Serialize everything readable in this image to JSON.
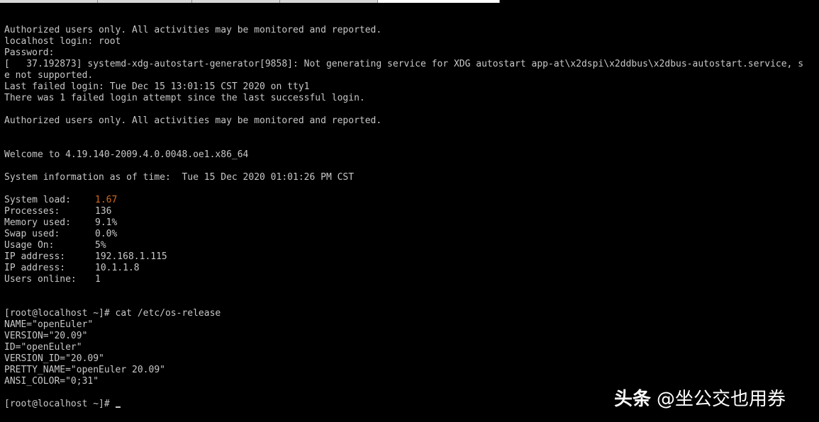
{
  "colors": {
    "background": "#000000",
    "text": "#c8c8c8",
    "highlight": "#d2691e",
    "watermark": "#ffffff"
  },
  "output_top": [
    "Authorized users only. All activities may be monitored and reported.",
    "localhost login: root",
    "Password:",
    "[   37.192873] systemd-xdg-autostart-generator[9858]: Not generating service for XDG autostart app-at\\x2dspi\\x2ddbus\\x2dbus-autostart.service, s",
    "e not supported.",
    "Last failed login: Tue Dec 15 13:01:15 CST 2020 on tty1",
    "There was 1 failed login attempt since the last successful login.",
    "",
    "Authorized users only. All activities may be monitored and reported.",
    "",
    "",
    "Welcome to 4.19.140-2009.4.0.0048.oe1.x86_64",
    "",
    "System information as of time:  Tue 15 Dec 2020 01:01:26 PM CST",
    ""
  ],
  "sysinfo": [
    {
      "label": "System load:",
      "value": "1.67"
    },
    {
      "label": "Processes:",
      "value": "136"
    },
    {
      "label": "Memory used:",
      "value": "9.1%"
    },
    {
      "label": "Swap used:",
      "value": "0.0%"
    },
    {
      "label": "Usage On:",
      "value": "5%"
    },
    {
      "label": "IP address:",
      "value": "192.168.1.115"
    },
    {
      "label": "IP address:",
      "value": "10.1.1.8"
    },
    {
      "label": "Users online:",
      "value": "1"
    }
  ],
  "output_bottom": [
    "",
    "",
    "[root@localhost ~]# cat /etc/os-release",
    "NAME=\"openEuler\"",
    "VERSION=\"20.09\"",
    "ID=\"openEuler\"",
    "VERSION_ID=\"20.09\"",
    "PRETTY_NAME=\"openEuler 20.09\"",
    "ANSI_COLOR=\"0;31\"",
    ""
  ],
  "prompt": "[root@localhost ~]# ",
  "watermark": {
    "brand": "头条",
    "handle": "@坐公交也用券"
  }
}
